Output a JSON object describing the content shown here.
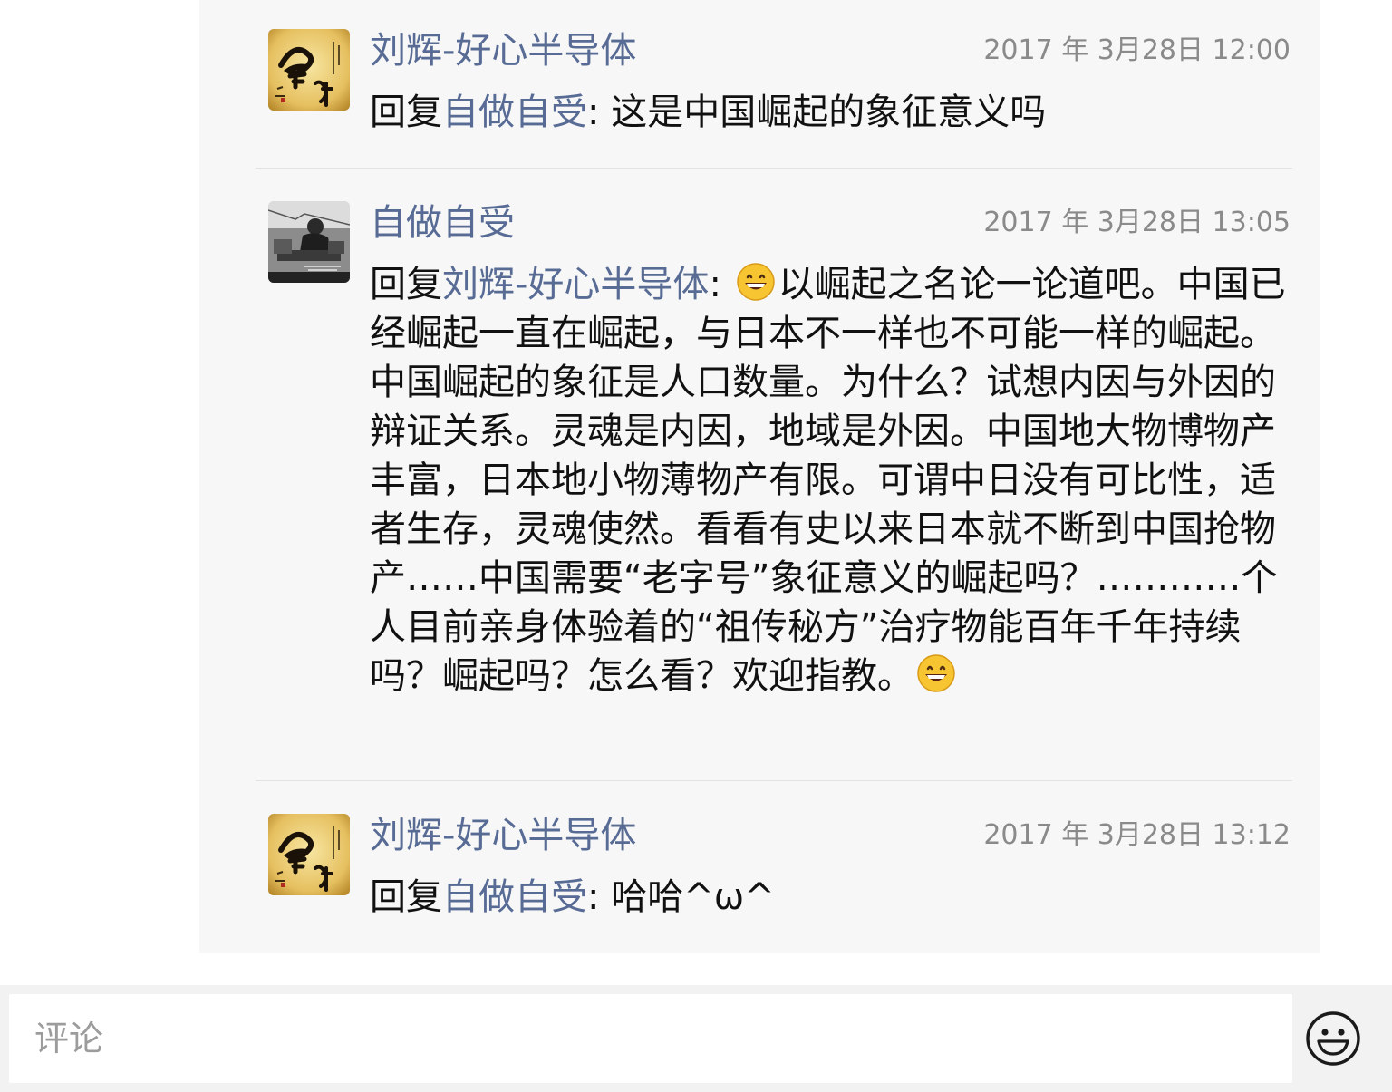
{
  "comments": [
    {
      "author": "刘辉-好心半导体",
      "timestamp": "2017 年 3月28日 12:00",
      "reply_prefix": "回复",
      "reply_to": "自做自受",
      "text": ": 这是中国崛起的象征意义吗",
      "avatar_icon": "calligraphy-avatar-icon"
    },
    {
      "author": "自做自受",
      "timestamp": "2017 年 3月28日 13:05",
      "reply_prefix": "回复",
      "reply_to": "刘辉-好心半导体",
      "text_pre": ": ",
      "text_main": "以崛起之名论一论道吧。中国已经崛起一直在崛起，与日本不一样也不可能一样的崛起。中国崛起的象征是人口数量。为什么？试想内因与外因的辩证关系。灵魂是内因，地域是外因。中国地大物博物产丰富，日本地小物薄物产有限。可谓中日没有可比性，适者生存，灵魂使然。看看有史以来日本就不断到中国抢物产……中国需要“老字号”象征意义的崛起吗？…………个人目前亲身体验着的“祖传秘方”治疗物能百年千年持续吗？崛起吗？怎么看？欢迎指教。",
      "avatar_icon": "photo-avatar-icon",
      "emoji_icon": "grinning-face-emoji"
    },
    {
      "author": "刘辉-好心半导体",
      "timestamp": "2017 年 3月28日 13:12",
      "reply_prefix": "回复",
      "reply_to": "自做自受",
      "text": ": 哈哈^ω^",
      "avatar_icon": "calligraphy-avatar-icon"
    }
  ],
  "input": {
    "placeholder": "评论",
    "emoji_button_icon": "smiley-face-icon"
  },
  "colors": {
    "link": "#576b95",
    "panel_bg": "#f7f7f7",
    "timestamp": "#8a8a8a"
  }
}
